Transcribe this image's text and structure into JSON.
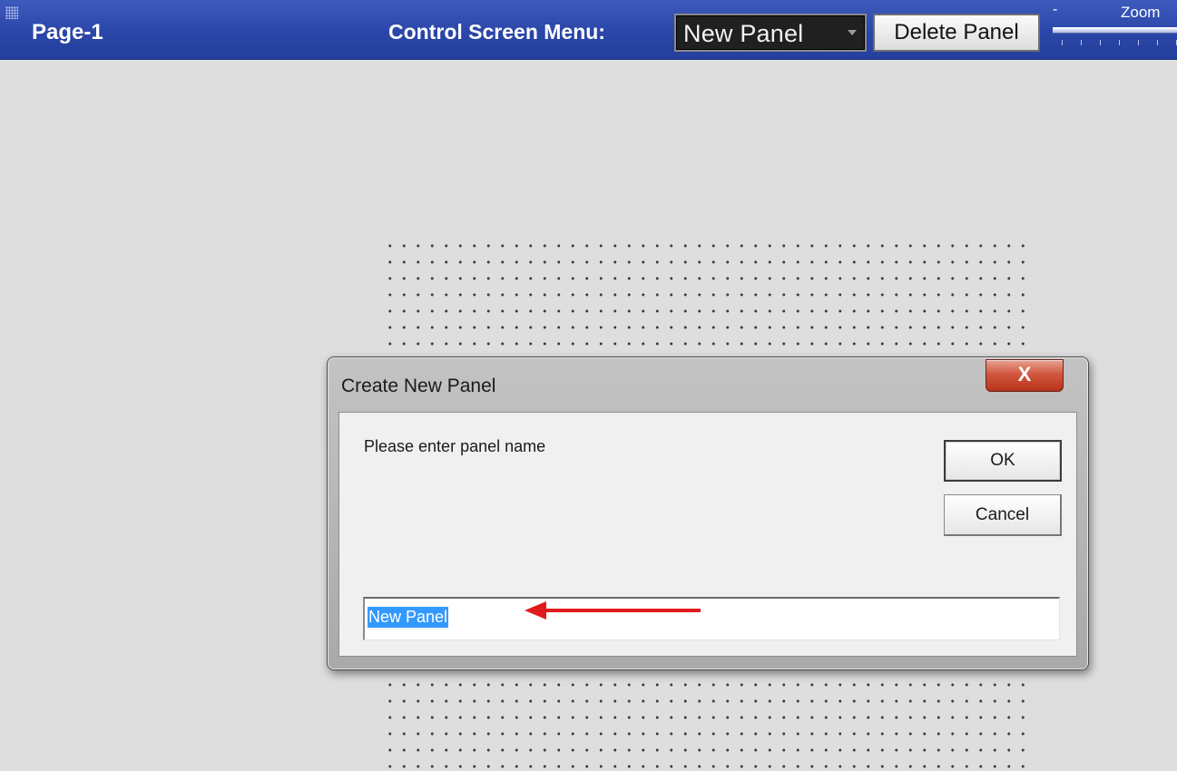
{
  "topbar": {
    "page_title": "Page-1",
    "menu_label": "Control Screen Menu:",
    "panel_select_value": "New Panel",
    "delete_button": "Delete Panel",
    "zoom_label": "Zoom",
    "zoom_minus": "-"
  },
  "dialog": {
    "title": "Create New Panel",
    "close_glyph": "X",
    "prompt": "Please enter panel name",
    "ok_button": "OK",
    "cancel_button": "Cancel",
    "input_value": "New Panel",
    "input_selected": true
  },
  "colors": {
    "topbar_blue": "#2a46a8",
    "selection_blue": "#3399ff",
    "annotation_red": "#e01b1b",
    "close_red": "#c8402a"
  },
  "icons": {
    "grip": "grip-dots-icon",
    "dropdown": "chevron-down-icon",
    "close": "close-icon",
    "annotation": "arrow-left-icon"
  }
}
